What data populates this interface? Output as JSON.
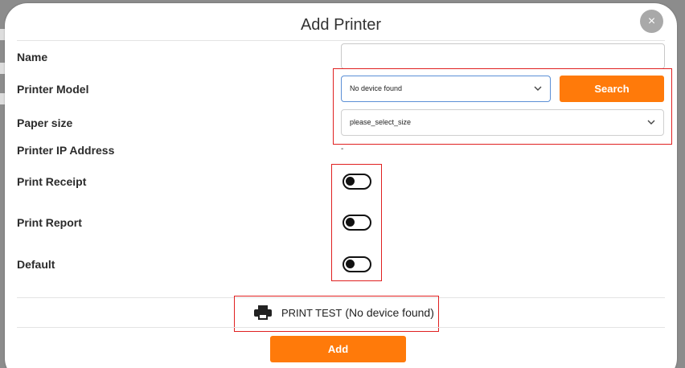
{
  "modal": {
    "title": "Add Printer",
    "close_glyph": "×"
  },
  "form": {
    "name_label": "Name",
    "name_value": "",
    "printer_model_label": "Printer Model",
    "printer_model_value": "No device found",
    "search_label": "Search",
    "paper_size_label": "Paper size",
    "paper_size_value": "please_select_size",
    "printer_ip_label": "Printer IP Address",
    "printer_ip_value": "-",
    "print_receipt_label": "Print Receipt",
    "print_receipt_on": false,
    "print_report_label": "Print Report",
    "print_report_on": false,
    "default_label": "Default",
    "default_on": false
  },
  "print_test": {
    "label": "PRINT TEST",
    "status": "(No device found)",
    "icon": "printer-icon"
  },
  "actions": {
    "add_label": "Add"
  },
  "colors": {
    "accent": "#ff7a0a",
    "highlight_box": "#e02020",
    "close_button": "#a9a9a9"
  }
}
